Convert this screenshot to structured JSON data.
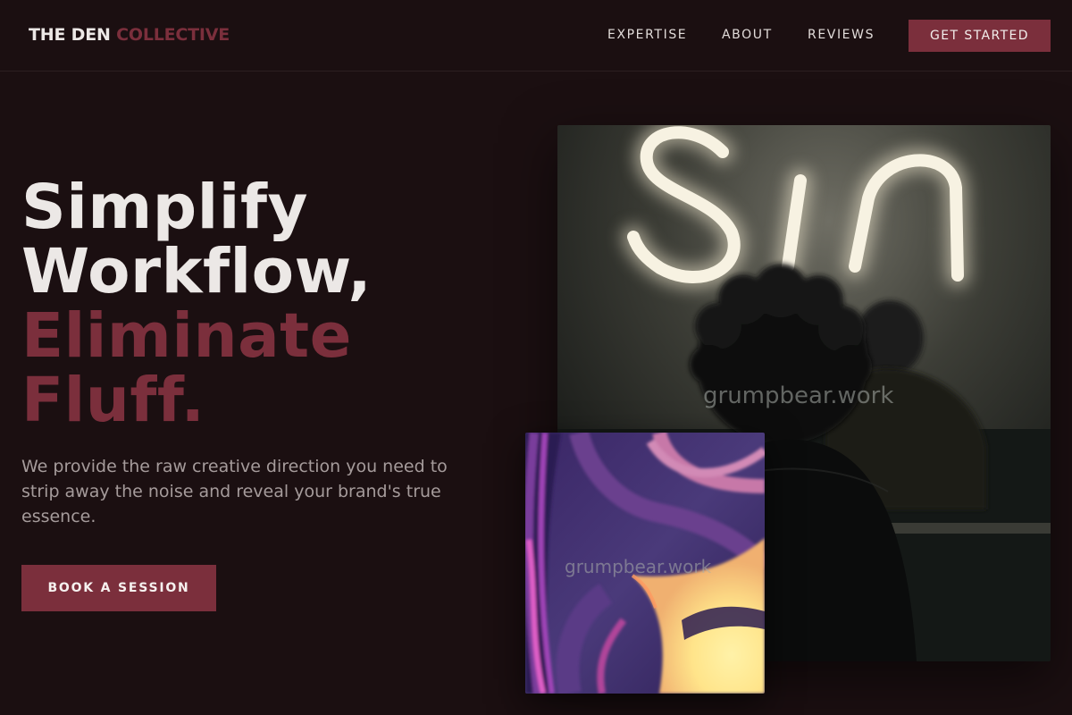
{
  "header": {
    "brand_primary": "THE DEN",
    "brand_accent": "COLLECTIVE",
    "nav": [
      "EXPERTISE",
      "ABOUT",
      "REVIEWS"
    ],
    "cta_label": "GET STARTED"
  },
  "hero": {
    "headline_lines": [
      "Simplify",
      "Workflow,",
      "Eliminate",
      "Fluff."
    ],
    "tagline": "We provide the raw creative direction you need to strip away the noise and reveal your brand's true essence.",
    "button_label": "BOOK A SESSION"
  },
  "images": {
    "main_photo": {
      "subject": "person facing neon sign",
      "neon_text": "Sin",
      "watermark": "grumpbear.work"
    },
    "art_panel": {
      "subject": "abstract purple and yellow paint swirl",
      "watermark": "grumpbear.work"
    }
  },
  "colors": {
    "background": "#1b0f11",
    "accent": "#7b2f3c",
    "text_light": "#ece8e6",
    "text_muted": "#a59b9b"
  }
}
